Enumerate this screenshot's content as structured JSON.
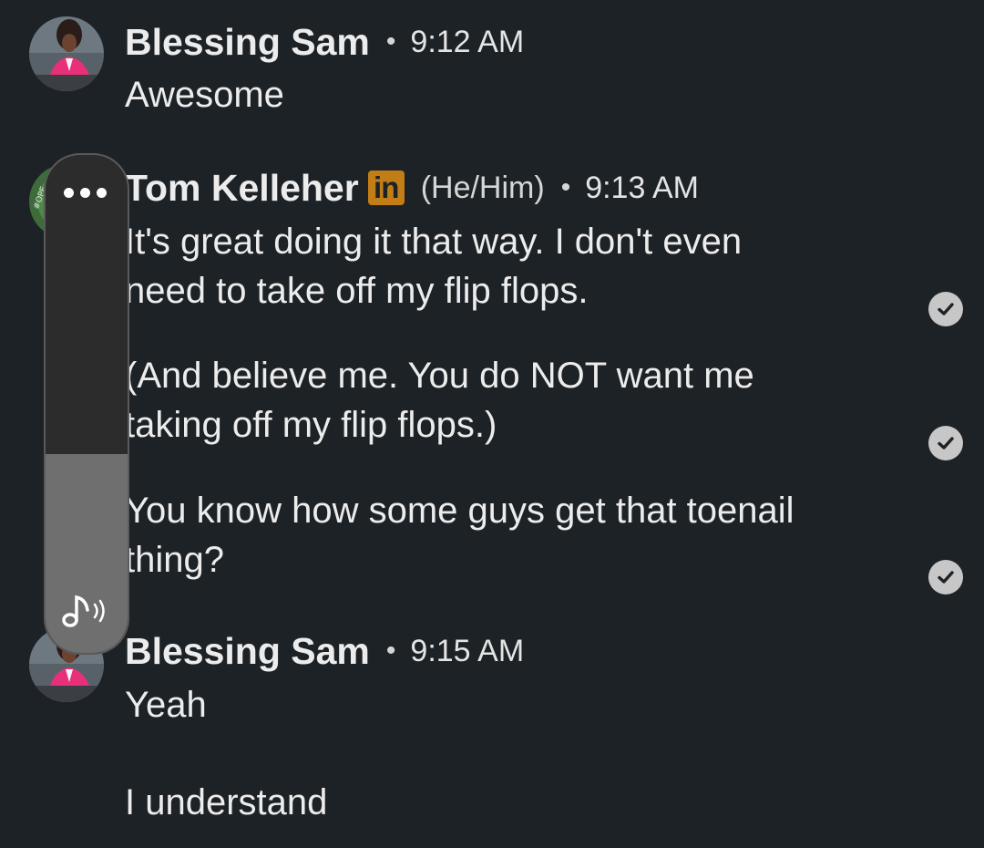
{
  "messages": [
    {
      "sender": "Blessing Sam",
      "time": "9:12 AM",
      "lines": [
        "Awesome"
      ]
    },
    {
      "sender": "Tom Kelleher",
      "badge": "in",
      "pronouns": "(He/Him)",
      "time": "9:13 AM",
      "paragraphs": [
        [
          "It's great doing it that way.  I don't even",
          "need to take off my flip flops."
        ],
        [
          "(And believe me.  You do NOT want me",
          "taking off my flip flops.)"
        ],
        [
          "You know how some guys get that toenail",
          "thing?"
        ]
      ]
    },
    {
      "sender": "Blessing Sam",
      "time": "9:15 AM",
      "lines": [
        "Yeah",
        "I understand"
      ]
    }
  ],
  "separator": "•",
  "avatar_badge_text": "#OPE",
  "colors": {
    "background": "#1d2226",
    "text": "#ececec",
    "linkedin_badge": "#c37d16",
    "read_check": "#c7c7c7",
    "overlay_panel": "#2c2c2c",
    "overlay_volume_fill": "#6f6f6f"
  },
  "icons": {
    "read_receipt": "check-circle-icon",
    "overlay_menu": "more-dots-icon",
    "overlay_volume": "speaker-note-icon"
  },
  "volume_overlay": {
    "level_fraction": 0.4
  }
}
